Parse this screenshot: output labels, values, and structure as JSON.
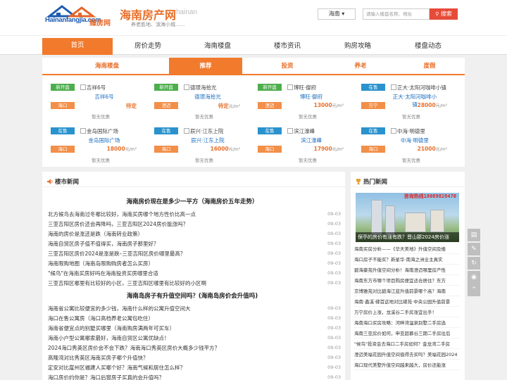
{
  "header": {
    "logo_en": "Hainanfangjia.com",
    "logo_cn": "臻房网",
    "site_title": "海南房产网",
    "site_sub": "hainan",
    "slogan": "养老胜地、滨海小城......",
    "city": "海南 ▾",
    "search_placeholder": "请输入楼盘名称、地址",
    "search_button": "搜索"
  },
  "nav": [
    "首页",
    "房价走势",
    "海南楼盘",
    "楼市资讯",
    "购房攻略",
    "楼盘动态"
  ],
  "tabs": [
    "海南楼盘",
    "推荐",
    "投资",
    "养老",
    "度假"
  ],
  "unit": "元/m²",
  "properties": [
    {
      "status": "新开盘",
      "pic": "吉祥6号",
      "name": "吉祥6号",
      "region": "海口",
      "price": "待定",
      "unit": "",
      "offer": "暂无优惠"
    },
    {
      "status": "新开盘",
      "pic": "德璟海拾光",
      "name": "德璟海拾光",
      "region": "澄迈",
      "price": "待定",
      "unit": "元/m²",
      "offer": "暂无优惠"
    },
    {
      "status": "新开盘",
      "pic": "博旺·御府",
      "name": "博旺·御府",
      "region": "澄迈",
      "price": "13000",
      "unit": "元/m²",
      "offer": "暂无优惠"
    },
    {
      "status": "在售",
      "pic": "正大·太阳河咖啡小镇",
      "name": "正大·太阳河咖啡小镇",
      "region": "万宁",
      "price": "28000",
      "unit": "元/m²",
      "offer": "暂无优惠"
    },
    {
      "status": "在售",
      "pic": "金岛国际广场",
      "name": "金岛国际广场",
      "region": "海口",
      "price": "18000",
      "unit": "元/m²",
      "offer": "暂无优惠"
    },
    {
      "status": "在售",
      "pic": "辰兴·江东上院",
      "name": "辰兴·江东上院",
      "region": "海口",
      "price": "16000",
      "unit": "元/m²",
      "offer": "暂无优惠"
    },
    {
      "status": "在售",
      "pic": "滨江濠峰",
      "name": "滨江濠峰",
      "region": "海口",
      "price": "17900",
      "unit": "元/m²",
      "offer": "暂无优惠"
    },
    {
      "status": "在售",
      "pic": "中海·明德里",
      "name": "中海·明德里",
      "region": "海口",
      "price": "21000",
      "unit": "元/m²",
      "offer": "暂无优惠"
    }
  ],
  "news": {
    "title": "楼市新闻",
    "group1_title": "海南房价现在是多少一平方（海南房价五年走势）",
    "group1": [
      {
        "t": "北方候鸟去海南过冬哪比较好，海南买房哪个地方性价比高一点",
        "d": "09-03"
      },
      {
        "t": "三亚吉阳区房价还会再降吗，三亚吉阳区2024房价能涨吗？",
        "d": "09-03"
      },
      {
        "t": "海南的房价是涨还是跌（海南转业政策）",
        "d": "09-03"
      },
      {
        "t": "海南自贸区房子值不值得买，海南房子那里好？",
        "d": "09-03"
      },
      {
        "t": "三亚吉阳区房价2024是涨是跌–三亚吉阳区房价哪里最高？",
        "d": "09-03"
      },
      {
        "t": "海南限购地图（海南岛限购购房者怎么买房）",
        "d": "09-03"
      },
      {
        "t": "\"候鸟\"在海南买房好吗在海南投资买房哪里合适",
        "d": "09-03"
      },
      {
        "t": "三亚吉阳区哪里有比较好的小区，三亚吉阳区哪里有比较好的小区啊",
        "d": "09-03"
      }
    ],
    "group2_title": "海南岛房子有升值空间吗？(海南岛房价会升值吗)",
    "group2": [
      {
        "t": "海南省公寓比较便宜的多少钱，海南什么样的公寓升值空间大",
        "d": "09-03"
      },
      {
        "t": "海口在售公寓房（海口高档养老公寓包吃住）",
        "d": "09-03"
      },
      {
        "t": "海南省便宜点的别墅买哪里（海南购房满两年可买车）",
        "d": "09-03"
      },
      {
        "t": "海南小户型公寓哪家最好，海南自贸区公寓优缺点！",
        "d": "09-03"
      },
      {
        "t": "2024海口秀英区房价会不会下跌？海南海口秀英区房价大概多少钱平方？",
        "d": "09-03"
      },
      {
        "t": "高隆湾对比秀英区海南买房子哪个升值快？",
        "d": "09-03"
      },
      {
        "t": "定安对比崖州区福建人买哪个好？海南气候和居住怎么样？",
        "d": "09-03"
      },
      {
        "t": "海口房价约你是？海口后窗房子买真的会升值吗？",
        "d": "09-03"
      }
    ]
  },
  "hot": {
    "title": "热门新闻",
    "banner_text": "咨询热线18089828470",
    "caption": "保亭的房价有涨有跌？晋山郡2024房价涨",
    "items": [
      "海南买房分析——《华天美地》升值空间及楼",
      "海口房子不能买？新星华·南海之洲业主真实",
      "碧海豪苑升值空间分析！海南澄迈哪里房产性",
      "海南东方市哪个项目购房便宜适合居住？东方",
      "京博雅苑对比碧海江蓝升值前景哪个高？海南",
      "海南·鑫溪·碟首这地对比碟苑·中央公园升值前景",
      "万宁房价上涨，龙溪谷二手房涨宜出手！",
      "海南海口买房攻略：河畔湾温泉别墅二手房选",
      "海南三亚房价如何，申亚超慕谷三期二手房往后",
      "\"候鸟\"投资会去海口二手房如何？金龙湾二手房",
      "澄迈美福花园升值空间值得去买吗？美福花园2024",
      "海口现代美墅升值空间越来越大，房价还能涨"
    ]
  }
}
